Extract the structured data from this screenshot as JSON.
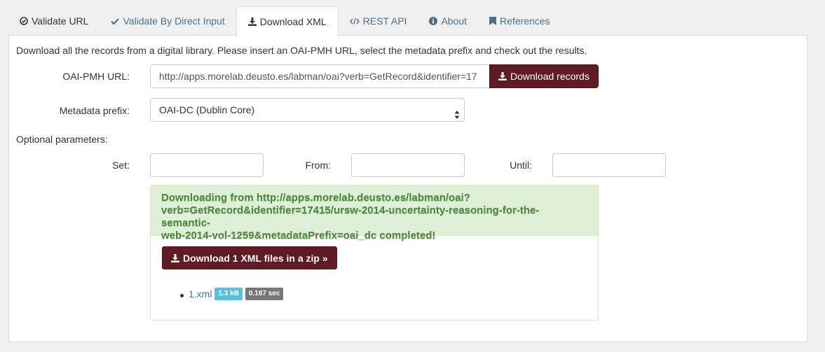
{
  "tabs": [
    {
      "label": "Validate URL",
      "icon": "check-circle-icon"
    },
    {
      "label": "Validate By Direct Input",
      "icon": "check-icon"
    },
    {
      "label": "Download XML",
      "icon": "download-icon"
    },
    {
      "label": "REST API",
      "icon": "code-icon"
    },
    {
      "label": "About",
      "icon": "info-circle-icon"
    },
    {
      "label": "References",
      "icon": "bookmark-icon"
    }
  ],
  "active_tab": "Download XML",
  "intro": "Download all the records from a digital library. Please insert an OAI-PMH URL, select the metadata prefix and check out the results.",
  "form": {
    "url_label": "OAI-PMH URL:",
    "url_value": "http://apps.morelab.deusto.es/labman/oai?verb=GetRecord&identifier=17",
    "download_records_label": "Download records",
    "metadata_label": "Metadata prefix:",
    "metadata_value": "OAI-DC (Dublin Core)",
    "optional_label": "Optional parameters:",
    "set_label": "Set:",
    "from_label": "From:",
    "until_label": "Until:"
  },
  "result": {
    "message": "Downloading from http://apps.morelab.deusto.es/labman/oai?verb=GetRecord&identifier=17415/ursw-2014-uncertainty-reasoning-for-the-semantic-web-2014-vol-1259&metadataPrefix=oai_dc completed!",
    "message_lines": [
      "Downloading from http://apps.morelab.deusto.es/labman/oai?",
      "verb=GetRecord&identifier=17415/ursw-2014-uncertainty-reasoning-for-the-semantic-",
      "web-2014-vol-1259&metadataPrefix=oai_dc completed!"
    ],
    "zip_button_label": "Download 1 XML files in a zip »",
    "files": [
      {
        "name": "1.xml",
        "size": "1.3 kB",
        "time": "0.167 sec"
      }
    ]
  },
  "colors": {
    "accent": "#5f1a24",
    "link": "#4f6f88",
    "success_bg": "#dff0d8",
    "success_text": "#3c763d",
    "badge_info": "#5bc0de",
    "badge_default": "#777777"
  }
}
